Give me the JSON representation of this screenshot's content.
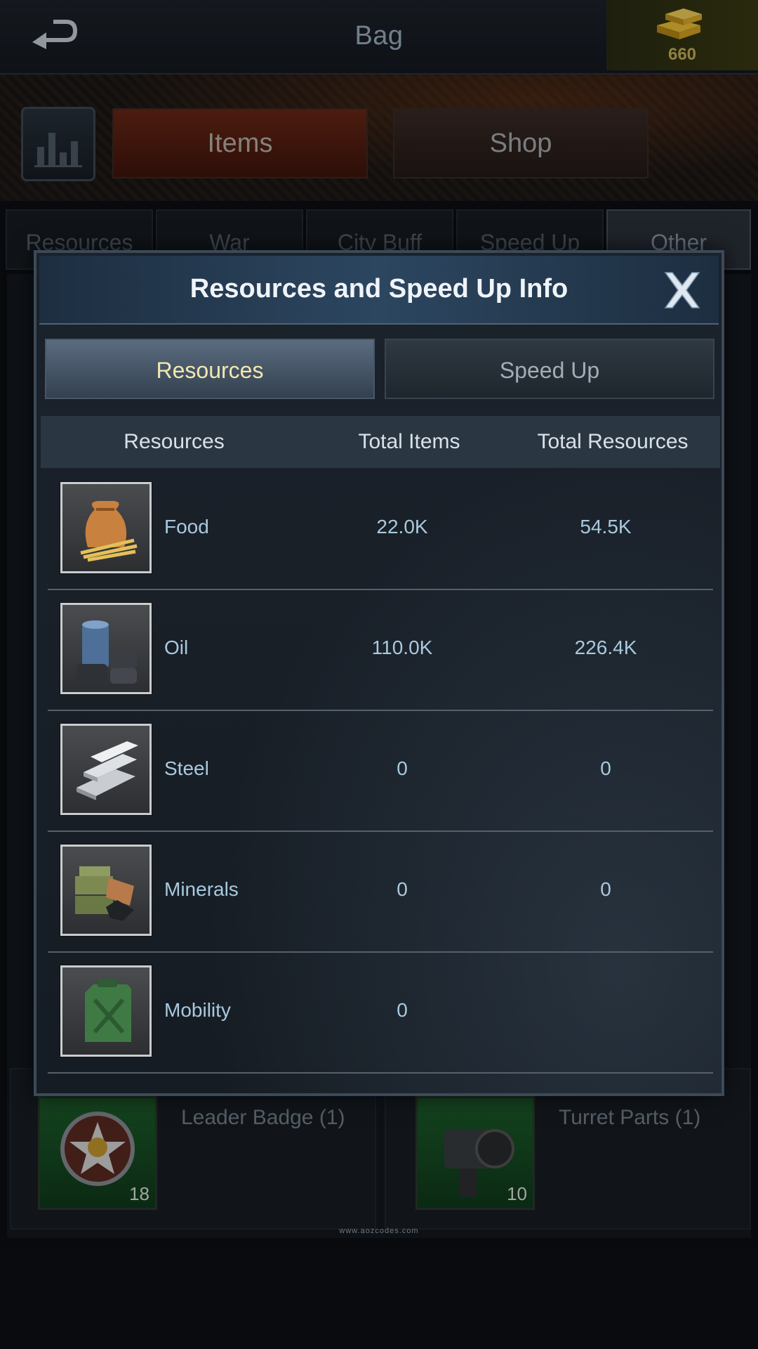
{
  "header": {
    "title": "Bag",
    "gold_amount": "660",
    "back_icon": "back-arrow-icon",
    "gold_icon": "gold-bars-icon"
  },
  "main_tabs": [
    {
      "label": "Items",
      "active": true
    },
    {
      "label": "Shop",
      "active": false
    }
  ],
  "category_tabs": [
    {
      "label": "Resources"
    },
    {
      "label": "War"
    },
    {
      "label": "City Buff"
    },
    {
      "label": "Speed Up"
    },
    {
      "label": "Other",
      "active": true
    }
  ],
  "background_items": [
    {
      "name": "Leader Badge (1)",
      "count": "18",
      "badge": "1"
    },
    {
      "name": "Turret Parts (1)",
      "count": "10",
      "badge": "1"
    }
  ],
  "watermark": "www.aozcodes.com",
  "modal": {
    "title": "Resources and Speed Up Info",
    "tabs": [
      {
        "label": "Resources",
        "active": true
      },
      {
        "label": "Speed Up",
        "active": false
      }
    ],
    "columns": [
      "Resources",
      "Total Items",
      "Total Resources"
    ],
    "rows": [
      {
        "name": "Food",
        "total_items": "22.0K",
        "total_resources": "54.5K",
        "icon": "food-sack-icon"
      },
      {
        "name": "Oil",
        "total_items": "110.0K",
        "total_resources": "226.4K",
        "icon": "oil-barrels-icon"
      },
      {
        "name": "Steel",
        "total_items": "0",
        "total_resources": "0",
        "icon": "steel-beams-icon"
      },
      {
        "name": "Minerals",
        "total_items": "0",
        "total_resources": "0",
        "icon": "minerals-crates-icon"
      },
      {
        "name": "Mobility",
        "total_items": "0",
        "total_resources": "",
        "icon": "fuel-can-icon"
      }
    ]
  },
  "colors": {
    "accent_tab": "#6a2716",
    "modal_header": "#2c4660",
    "value_text": "#a9c9de"
  }
}
